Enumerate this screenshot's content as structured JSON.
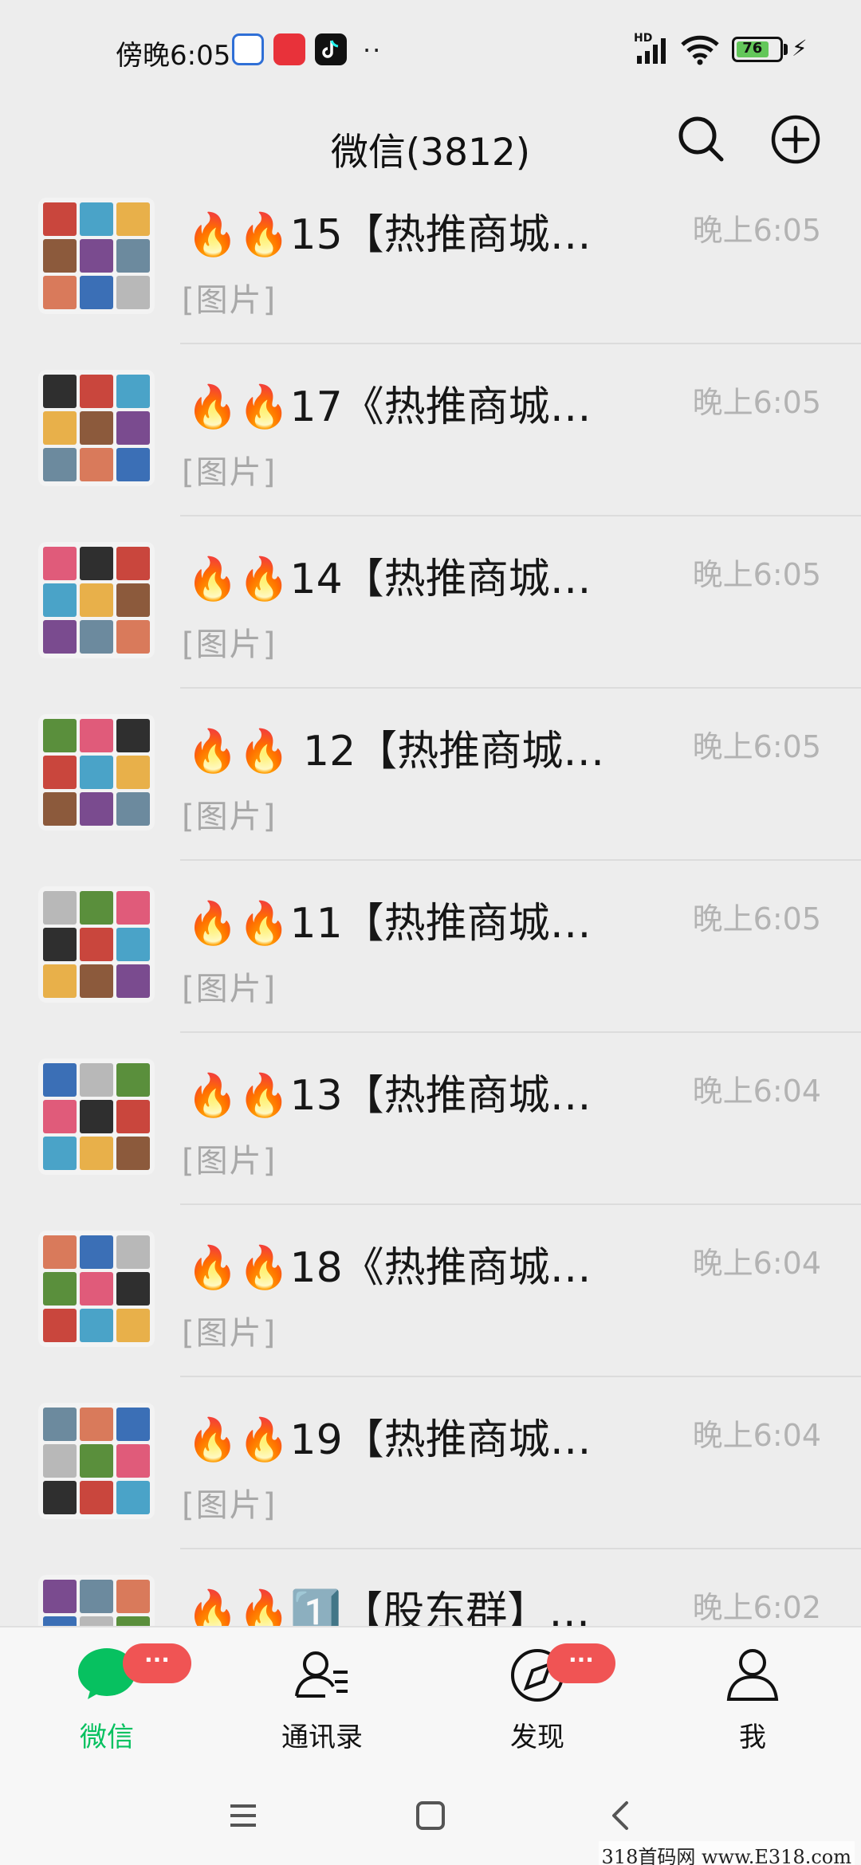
{
  "status_bar": {
    "time": "傍晚6:05",
    "dots": "··",
    "network": "HD",
    "battery": "76",
    "battery_level": 0.76
  },
  "header": {
    "title": "微信(3812)",
    "search_icon": "search-icon",
    "add_icon": "plus-circle-icon"
  },
  "chats": [
    {
      "name": "🔥🔥15【热推商城…",
      "message": "[图片]",
      "time": "晚上6:05"
    },
    {
      "name": "🔥🔥17《热推商城…",
      "message": "[图片]",
      "time": "晚上6:05"
    },
    {
      "name": "🔥🔥14【热推商城…",
      "message": "[图片]",
      "time": "晚上6:05"
    },
    {
      "name": "🔥🔥 12【热推商城…",
      "message": "[图片]",
      "time": "晚上6:05"
    },
    {
      "name": "🔥🔥11【热推商城…",
      "message": "[图片]",
      "time": "晚上6:05"
    },
    {
      "name": "🔥🔥13【热推商城…",
      "message": "[图片]",
      "time": "晚上6:04"
    },
    {
      "name": "🔥🔥18《热推商城…",
      "message": "[图片]",
      "time": "晚上6:04"
    },
    {
      "name": "🔥🔥19【热推商城…",
      "message": "[图片]",
      "time": "晚上6:04"
    },
    {
      "name": "🔥🔥1️⃣【股东群】…",
      "message": "",
      "time": "晚上6:02"
    }
  ],
  "tabs": [
    {
      "label": "微信",
      "icon": "chat-bubble-icon",
      "badge": "···",
      "active": true
    },
    {
      "label": "通讯录",
      "icon": "contacts-icon",
      "badge": "",
      "active": false
    },
    {
      "label": "发现",
      "icon": "compass-icon",
      "badge": "···",
      "active": false
    },
    {
      "label": "我",
      "icon": "person-icon",
      "badge": "",
      "active": false
    }
  ],
  "nav": {
    "menu_icon": "menu-icon",
    "home_icon": "home-square-icon",
    "back_icon": "back-chevron-icon"
  },
  "watermark": "318首码网 www.E318.com",
  "colors": {
    "accent": "#07c160",
    "badge": "#f05454",
    "background": "#ededed"
  }
}
